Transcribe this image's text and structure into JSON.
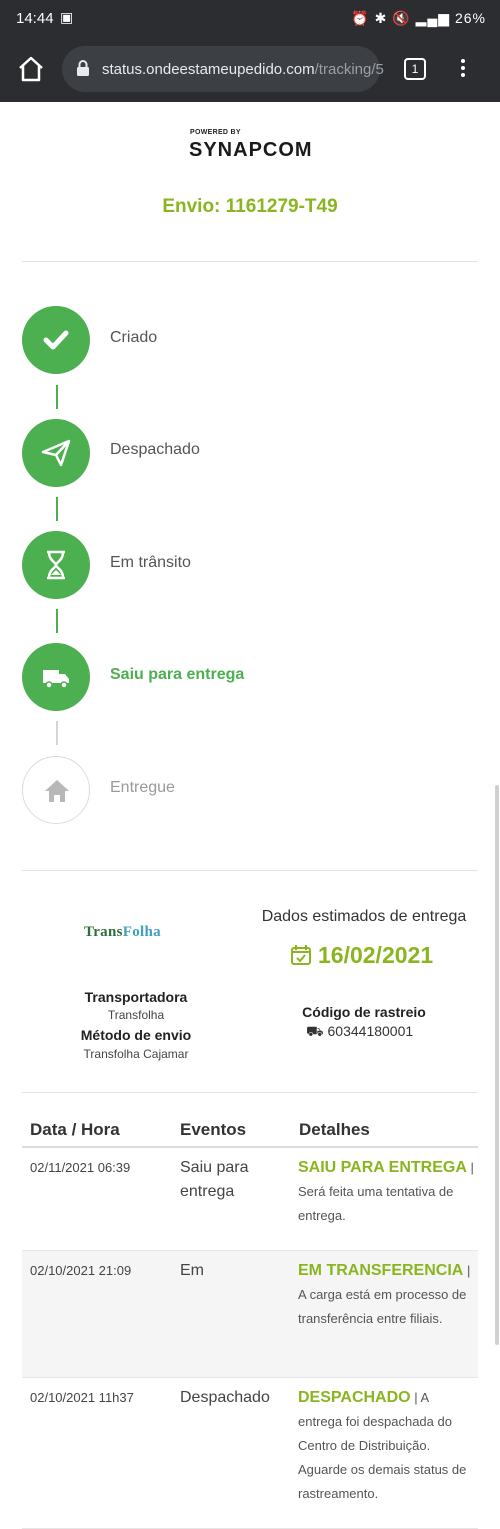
{
  "status_bar": {
    "time": "14:44",
    "battery": "26%"
  },
  "browser": {
    "url_host": "status.ondeestameupedido.com",
    "url_path": "/tracking/5",
    "tab_count": "1"
  },
  "brand": {
    "powered_by": "POWERED BY",
    "name": "SYNAPCOM"
  },
  "shipment": {
    "title": "Envio: 1161279-T49"
  },
  "steps": [
    {
      "label": "Criado",
      "icon": "check-icon",
      "state": "done"
    },
    {
      "label": "Despachado",
      "icon": "paper-plane-icon",
      "state": "done"
    },
    {
      "label": "Em trânsito",
      "icon": "hourglass-icon",
      "state": "done"
    },
    {
      "label": "Saiu para entrega",
      "icon": "truck-icon",
      "state": "current"
    },
    {
      "label": "Entregue",
      "icon": "home-icon",
      "state": "pending"
    }
  ],
  "carrier": {
    "logo_text_a": "Trans",
    "logo_text_b": "Folha",
    "carrier_label": "Transportadora",
    "carrier_value": "Transfolha",
    "method_label": "Método de envio",
    "method_value": "Transfolha Cajamar"
  },
  "delivery": {
    "estimate_label": "Dados estimados de entrega",
    "estimate_date": "16/02/2021",
    "tracking_label": "Código de rastreio",
    "tracking_code": "60344180001"
  },
  "table": {
    "headers": [
      "Data / Hora",
      "Eventos",
      "Detalhes"
    ],
    "rows": [
      {
        "date": "02/11/2021 06:39",
        "event": "Saiu para entrega",
        "status": "SAIU PARA ENTREGA",
        "detail": "Será feita uma tentativa de entrega."
      },
      {
        "date": "02/10/2021 21:09",
        "event": "Em",
        "status": "EM TRANSFERENCIA",
        "detail": "A carga está em processo de transferência entre filiais."
      },
      {
        "date": "02/10/2021 11h37",
        "event": "Despachado",
        "status": "DESPACHADO",
        "detail": "A entrega foi despachada do Centro de Distribuição. Aguarde os demais status de rastreamento."
      }
    ]
  },
  "colors": {
    "accent": "#8ab51f",
    "step_green": "#4caf50",
    "bar_dark": "#2b2d31"
  }
}
